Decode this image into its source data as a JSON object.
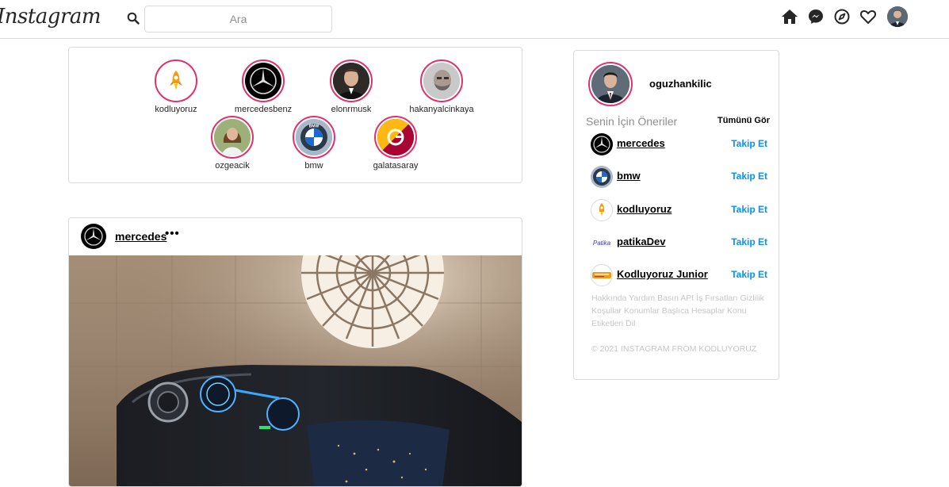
{
  "header": {
    "logo_text": "Instagram",
    "search_placeholder": "Ara",
    "icons": [
      "home-icon",
      "messenger-icon",
      "explore-icon",
      "heart-icon",
      "profile-avatar"
    ]
  },
  "stories": [
    {
      "name": "kodluyoruz",
      "icon": "kodluyoruz-rocket-logo"
    },
    {
      "name": "mercedesbenz",
      "icon": "mercedes-star-logo"
    },
    {
      "name": "elonrmusk",
      "icon": "portrait-photo"
    },
    {
      "name": "hakanyalcinkaya",
      "icon": "portrait-photo"
    },
    {
      "name": "ozgeacik",
      "icon": "portrait-photo"
    },
    {
      "name": "bmw",
      "icon": "bmw-logo"
    },
    {
      "name": "galatasaray",
      "icon": "galatasaray-logo"
    }
  ],
  "post": {
    "username": "mercedes",
    "more": "•••",
    "image": "mercedes-interior-hyperscreen-photo"
  },
  "sidebar": {
    "current_user": "oguzhankilic",
    "suggestions_title": "Senin İçin Öneriler",
    "see_all": "Tümünü Gör",
    "suggestions": [
      {
        "name": "mercedes",
        "action": "Takip Et",
        "icon": "mercedes-star-logo"
      },
      {
        "name": "bmw",
        "action": "Takip Et",
        "icon": "bmw-logo"
      },
      {
        "name": "kodluyoruz",
        "action": "Takip Et",
        "icon": "kodluyoruz-rocket-logo"
      },
      {
        "name": "patikaDev",
        "action": "Takip Et",
        "icon": "patika-logo"
      },
      {
        "name": " Kodluyoruz Junior",
        "action": "Takip Et",
        "icon": "kodluyoruz-junior-logo"
      }
    ],
    "footer_links": "Hakkında Yardım Basın API İş Fırsatları Gizlilik Koşullar Konumlar Başlıca Hesaplar Konu Etiketleri Dil",
    "copyright": "© 2021 INSTAGRAM FROM KODLUYORUZ",
    "patika_logo_text": "Patika"
  },
  "colors": {
    "story_ring": "#e1306c",
    "follow_blue": "#0095f6",
    "border": "#dbdbdb",
    "muted_text": "#8e8e8e"
  }
}
